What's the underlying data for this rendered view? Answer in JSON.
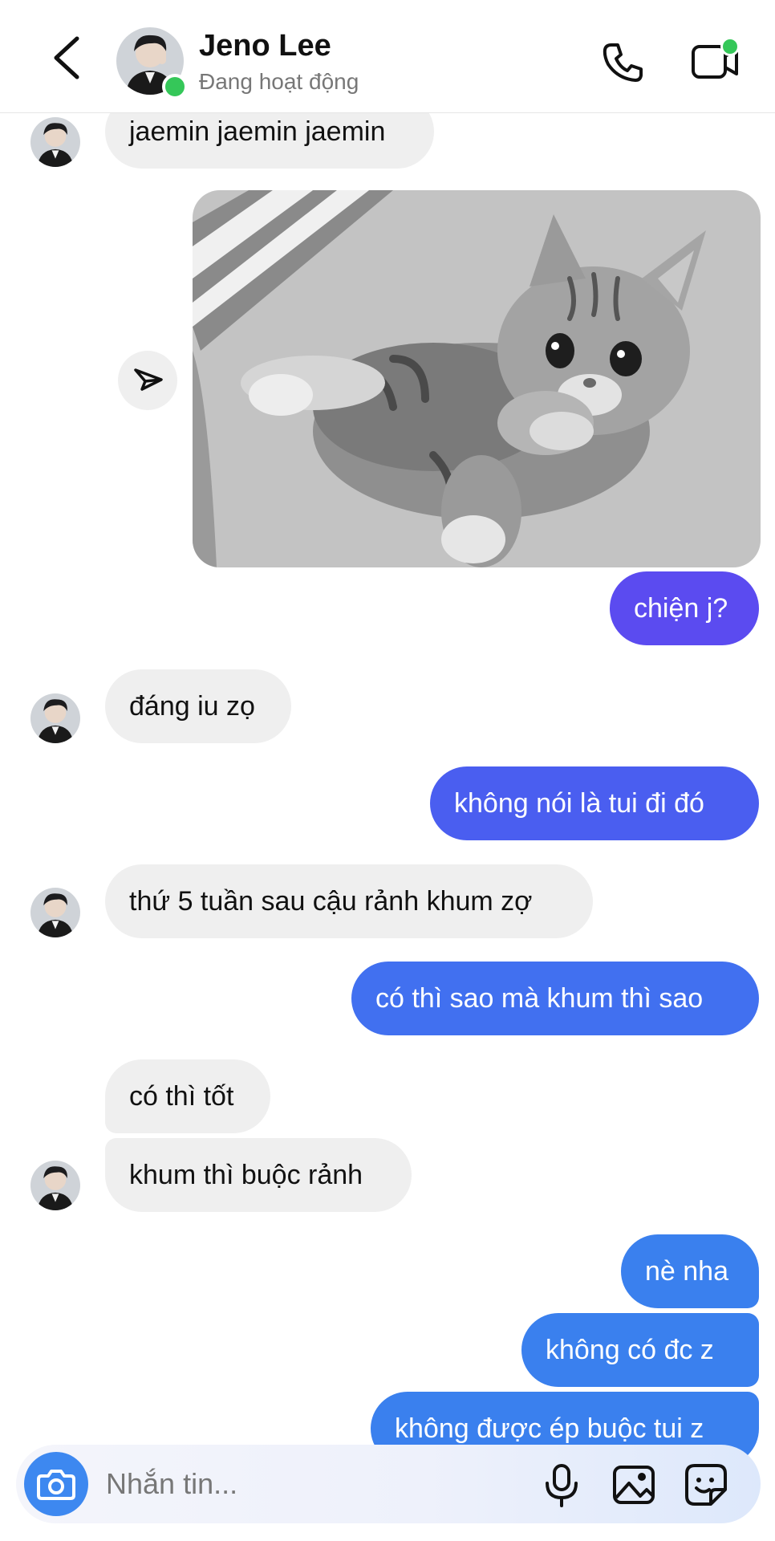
{
  "header": {
    "name": "Jeno Lee",
    "status": "Đang hoạt động"
  },
  "messages": [
    {
      "side": "in",
      "text": "jaemin jaemin jaemin"
    },
    {
      "side": "out",
      "type": "photo",
      "content": "kitten photo"
    },
    {
      "side": "out",
      "text": "chiện j?"
    },
    {
      "side": "in",
      "text": "đáng iu zọ"
    },
    {
      "side": "out",
      "text": "không nói là tui đi đó"
    },
    {
      "side": "in",
      "text": "thứ 5 tuần sau cậu rảnh khum zợ"
    },
    {
      "side": "out",
      "text": "có thì sao mà khum thì sao"
    },
    {
      "side": "in",
      "text": "có thì tốt"
    },
    {
      "side": "in",
      "text": "khum thì buộc rảnh"
    },
    {
      "side": "out",
      "text": "nè nha"
    },
    {
      "side": "out",
      "text": "không có đc z"
    },
    {
      "side": "out",
      "text": "không được ép buộc tui z"
    }
  ],
  "composer": {
    "placeholder": "Nhắn tin..."
  },
  "icons": {
    "back": "chevron-left-icon",
    "call": "phone-icon",
    "video": "video-camera-icon",
    "share": "send-icon",
    "camera": "camera-icon",
    "mic": "microphone-icon",
    "gallery": "image-icon",
    "sticker": "sticker-icon"
  },
  "colors": {
    "online": "#35c759",
    "incoming_bubble": "#efefef",
    "outgoing_purple": "#5b4bf0",
    "outgoing_blue": "#3a80ee",
    "camera_button": "#3d88f0"
  }
}
